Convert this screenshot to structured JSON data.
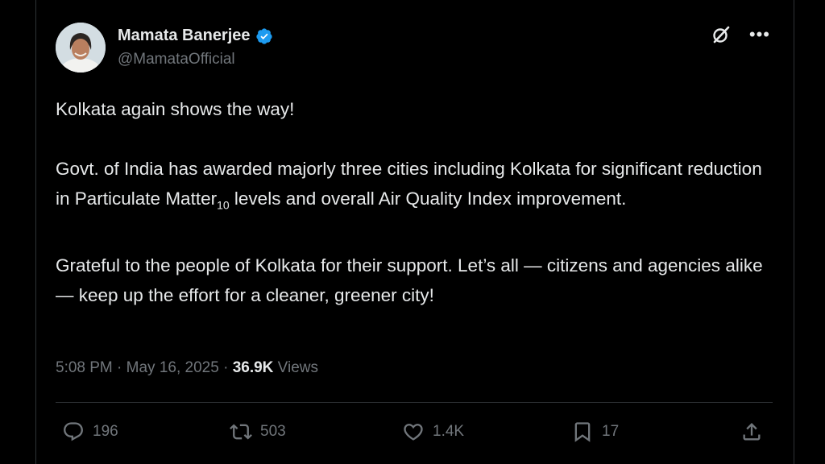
{
  "author": {
    "name": "Mamata Banerjee",
    "handle": "@MamataOfficial"
  },
  "tweet": {
    "line1": "Kolkata again shows the way!",
    "para2_a": "Govt. of India has awarded majorly three cities including Kolkata for significant reduction in Particulate Matter",
    "para2_sub": "10",
    "para2_b": " levels and overall Air Quality Index improvement.",
    "para3": "Grateful to the people of Kolkata for their support. Let’s all — citizens and agencies alike — keep up the effort for a cleaner, greener city!"
  },
  "meta": {
    "time": "5:08 PM",
    "sep1": " · ",
    "date": "May 16, 2025",
    "sep2": " · ",
    "views_count": "36.9K",
    "views_label": " Views"
  },
  "actions": {
    "replies": "196",
    "reposts": "503",
    "likes": "1.4K",
    "bookmarks": "17"
  },
  "icons": [
    "verified-icon",
    "grok-icon",
    "more-icon",
    "reply-icon",
    "repost-icon",
    "like-icon",
    "bookmark-icon",
    "share-icon"
  ],
  "colors": {
    "background": "#000000",
    "text": "#e7e9ea",
    "muted": "#71767b",
    "verified": "#1d9bf0",
    "divider": "#2f3336"
  }
}
